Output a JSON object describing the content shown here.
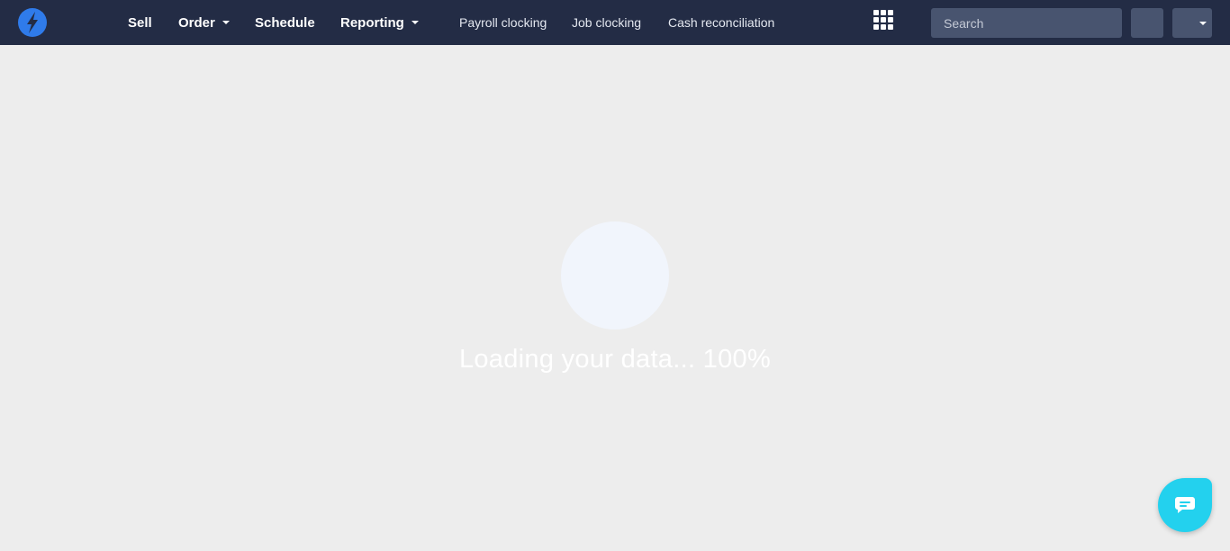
{
  "app": {
    "accent_color": "#2f7bea",
    "topbar_color": "#232c45",
    "logo_icon": "lightning-bolt"
  },
  "nav": {
    "sell": "Sell",
    "order": "Order",
    "schedule": "Schedule",
    "reporting": "Reporting",
    "payroll_clocking": "Payroll clocking",
    "job_clocking": "Job clocking",
    "cash_reconciliation": "Cash reconciliation"
  },
  "search": {
    "placeholder": "Search",
    "value": ""
  },
  "loading": {
    "text": "Loading your data... 100%",
    "progress_percent": 100
  },
  "chat": {
    "icon": "chat-bubble",
    "color": "#23d1ee"
  }
}
